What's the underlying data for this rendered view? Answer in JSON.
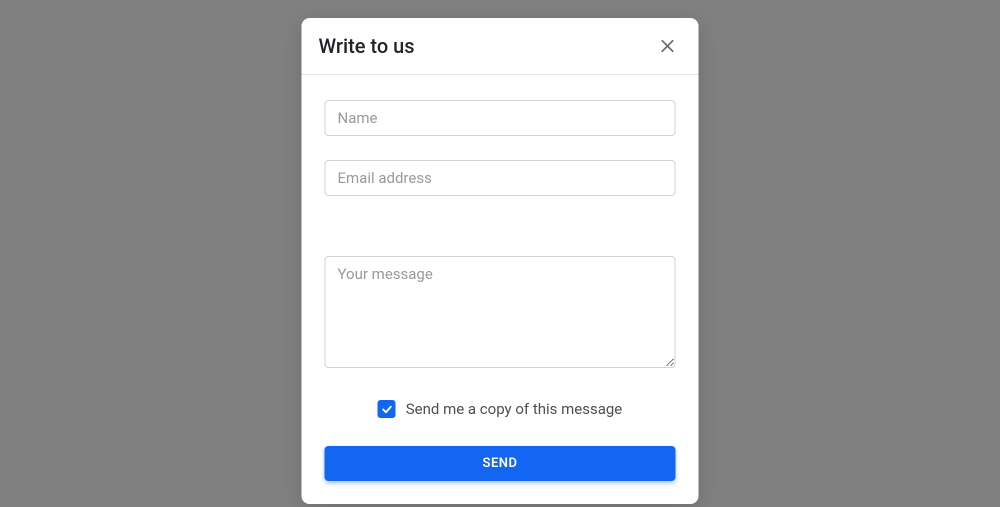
{
  "modal": {
    "title": "Write to us",
    "fields": {
      "name_placeholder": "Name",
      "email_placeholder": "Email address",
      "message_placeholder": "Your message",
      "name_value": "",
      "email_value": "",
      "message_value": ""
    },
    "checkbox": {
      "checked": true,
      "label": "Send me a copy of this message"
    },
    "send_button": "Send"
  }
}
